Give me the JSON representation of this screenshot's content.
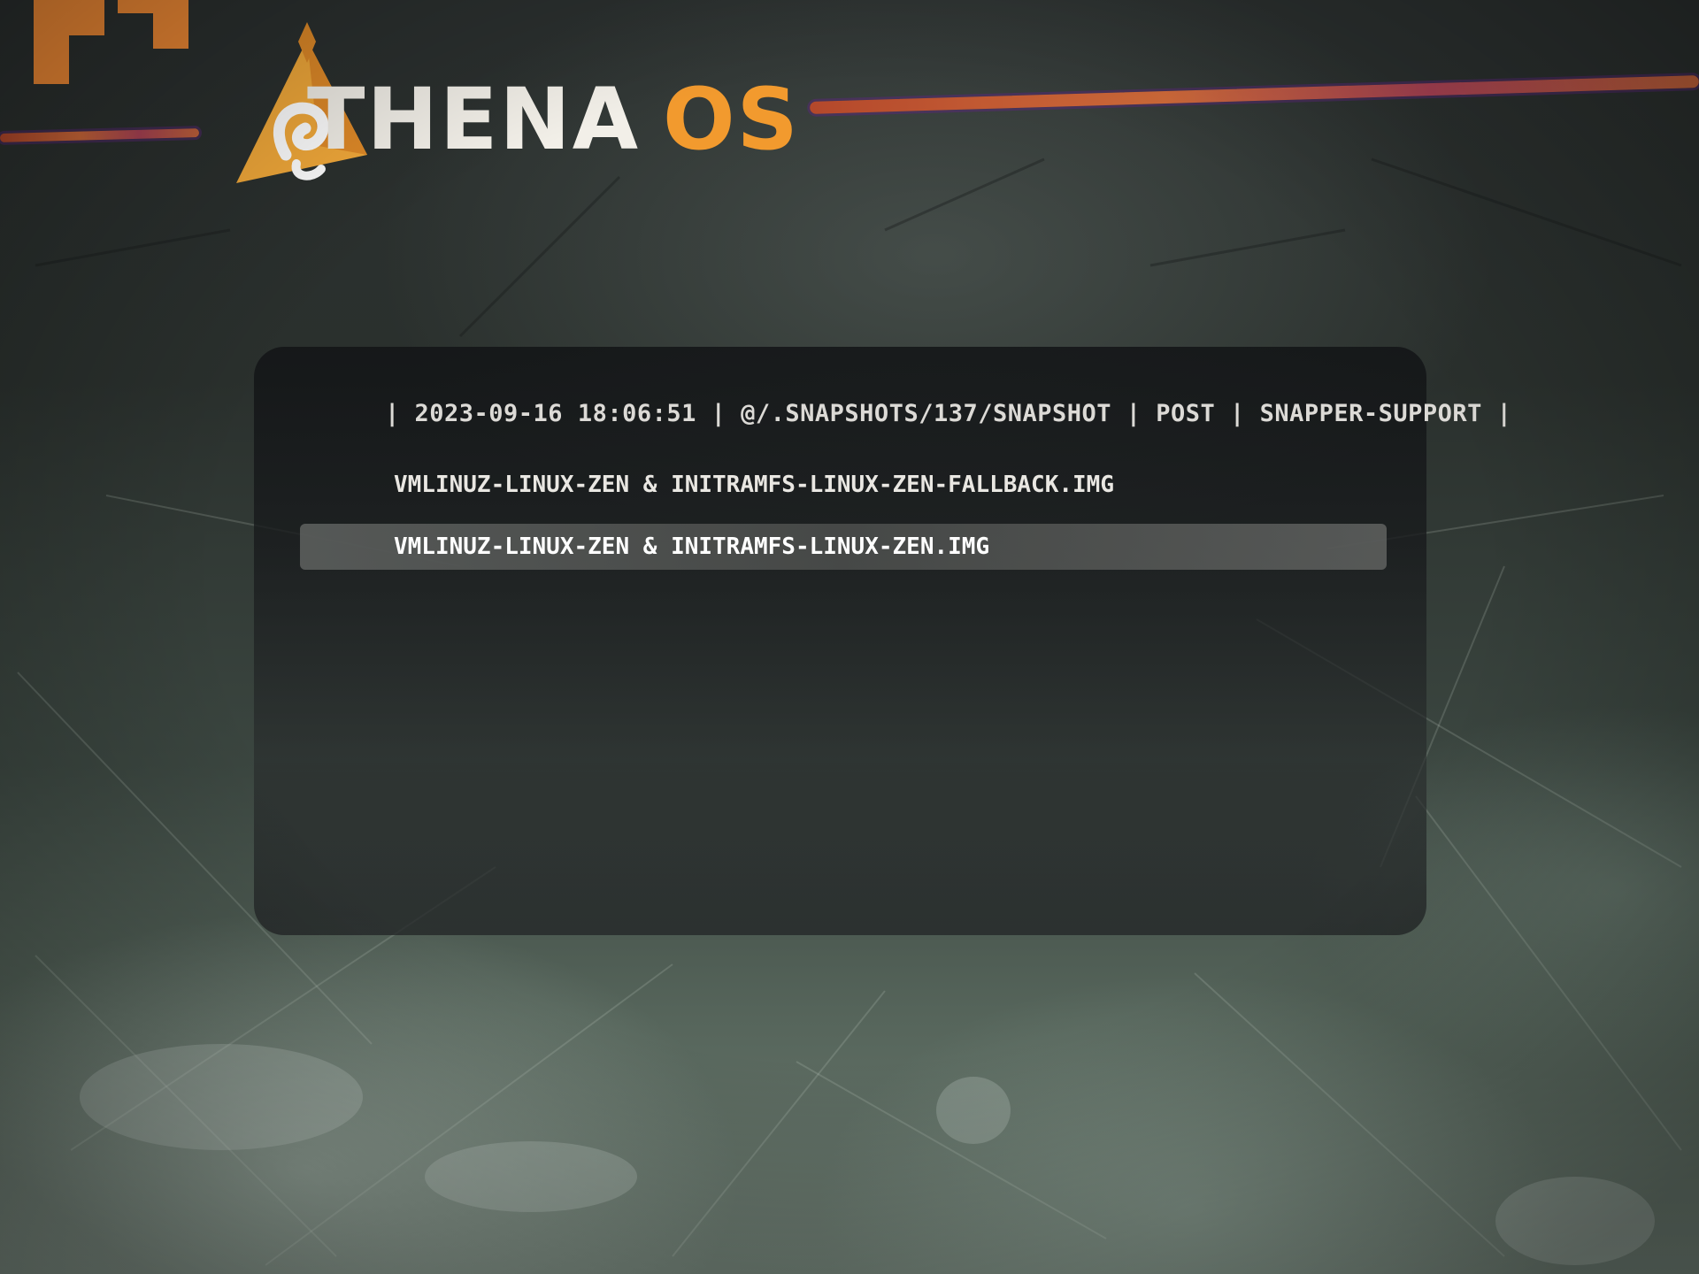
{
  "branding": {
    "name_part1": "THENA",
    "name_part2": "OS",
    "colors": {
      "accent_orange": "#f29a2e",
      "logo_white": "#f2efe8",
      "brush_stroke": "#d8663a"
    },
    "icon": "athena-triangle-logo"
  },
  "boot_menu": {
    "header": "| 2023-09-16 18:06:51 | @/.SNAPSHOTS/137/SNAPSHOT | POST | SNAPPER-SUPPORT |",
    "entries": [
      {
        "label": "VMLINUZ-LINUX-ZEN & INITRAMFS-LINUX-ZEN-FALLBACK.IMG",
        "selected": false
      },
      {
        "label": "VMLINUZ-LINUX-ZEN & INITRAMFS-LINUX-ZEN.IMG",
        "selected": true
      }
    ]
  }
}
